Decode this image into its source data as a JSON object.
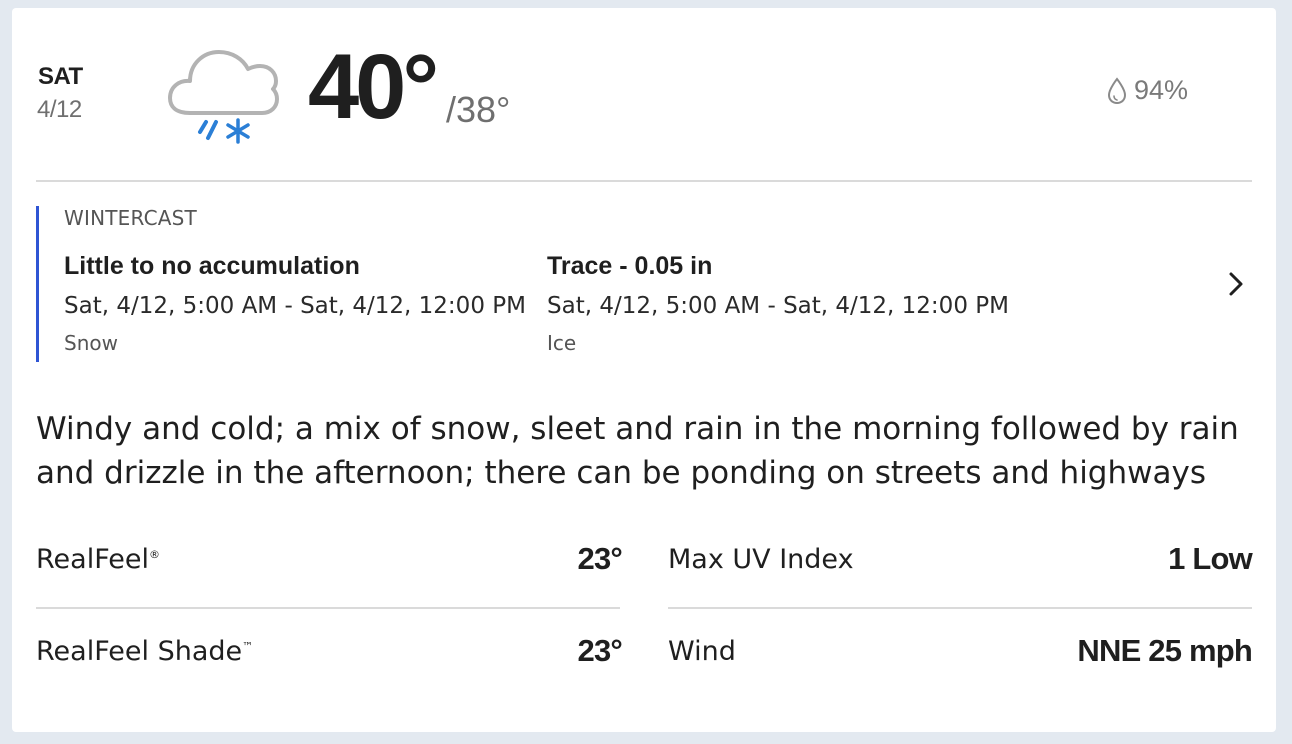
{
  "day": {
    "name": "SAT",
    "date": "4/12",
    "icon": "rain-snow-mix-icon",
    "high": "40°",
    "low": "/38°",
    "precip_icon": "raindrop-icon",
    "precip_probability": "94%"
  },
  "wintercast": {
    "label": "WINTERCAST",
    "items": [
      {
        "title": "Little to no accumulation",
        "range": "Sat, 4/12, 5:00 AM - Sat, 4/12, 12:00 PM",
        "type": "Snow"
      },
      {
        "title": "Trace - 0.05 in",
        "range": "Sat, 4/12, 5:00 AM - Sat, 4/12, 12:00 PM",
        "type": "Ice"
      }
    ],
    "accent_color": "#2f55d4",
    "chevron_icon": "chevron-right-icon"
  },
  "description": "Windy and cold; a mix of snow, sleet and rain in the morning followed by rain and drizzle in the afternoon; there can be ponding on streets and highways",
  "details": {
    "realfeel_label": "RealFeel",
    "realfeel_mark": "®",
    "realfeel_value": "23°",
    "realfeel_shade_label": "RealFeel Shade",
    "realfeel_shade_mark": "™",
    "realfeel_shade_value": "23°",
    "uv_label": "Max UV Index",
    "uv_value": "1 Low",
    "wind_label": "Wind",
    "wind_value": "NNE 25 mph"
  },
  "colors": {
    "background": "#e3e9f0",
    "card": "#ffffff",
    "icon_snow_blue": "#2b7fd6",
    "cloud_gray": "#b3b3b3"
  }
}
